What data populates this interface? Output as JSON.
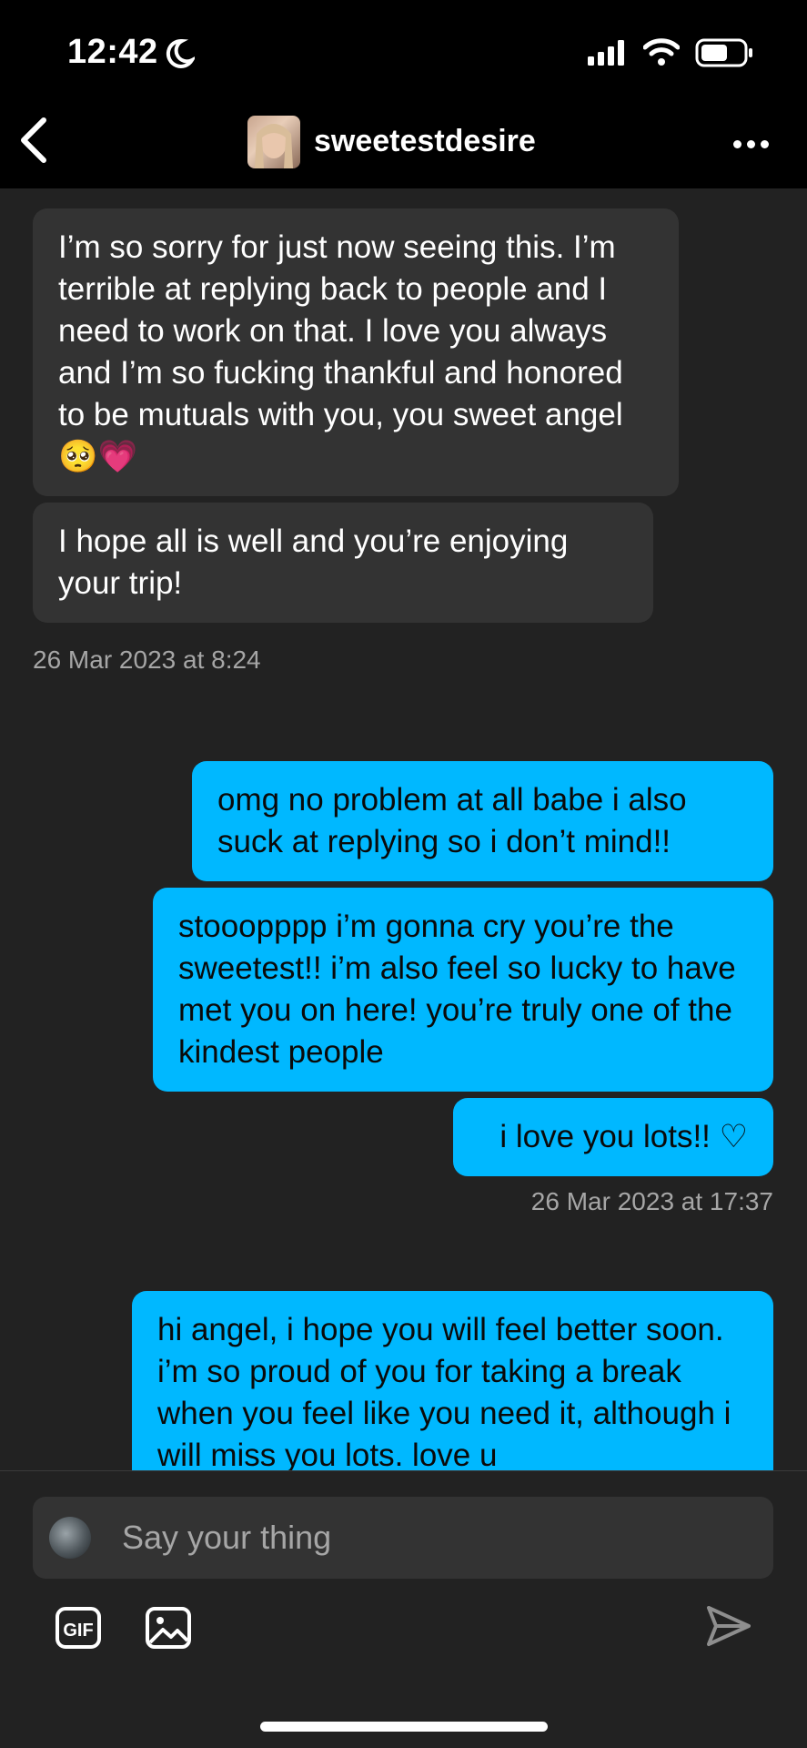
{
  "status_bar": {
    "time": "12:42"
  },
  "header": {
    "username": "sweetestdesire"
  },
  "messages": [
    {
      "direction": "in",
      "text": "I’m so sorry for just now seeing this. I’m terrible at replying back to people and I need to work on that. I love you always and I’m so fucking thankful and honored to be mutuals with you, you sweet angel 🥺💗"
    },
    {
      "direction": "in",
      "text": "I hope all is well and you’re enjoying your trip!"
    },
    {
      "direction": "out",
      "text": "omg no problem at all babe i also suck at replying so i don’t mind!!"
    },
    {
      "direction": "out",
      "text": "stooopppp i’m gonna cry you’re the sweetest!! i’m also feel so lucky to have met you on here! you’re truly one of the kindest people"
    },
    {
      "direction": "out",
      "text": "i love you lots!! ♡"
    },
    {
      "direction": "out",
      "text": "hi angel, i hope you will feel better soon. i’m so proud of you for taking a break when you feel like you need it, although i will miss you lots. love u"
    }
  ],
  "timestamps": [
    "26 Mar 2023 at 8:24",
    "26 Mar 2023 at 17:37"
  ],
  "composer": {
    "placeholder": "Say your thing"
  },
  "icons": {
    "back": "chevron-left-icon",
    "more": "more-horizontal-icon",
    "gif": "gif-icon",
    "image": "image-icon",
    "send": "send-icon"
  },
  "colors": {
    "background": "#222222",
    "incoming_bubble": "#333333",
    "outgoing_bubble": "#00b8ff",
    "timestamp": "#a6a6a6"
  }
}
